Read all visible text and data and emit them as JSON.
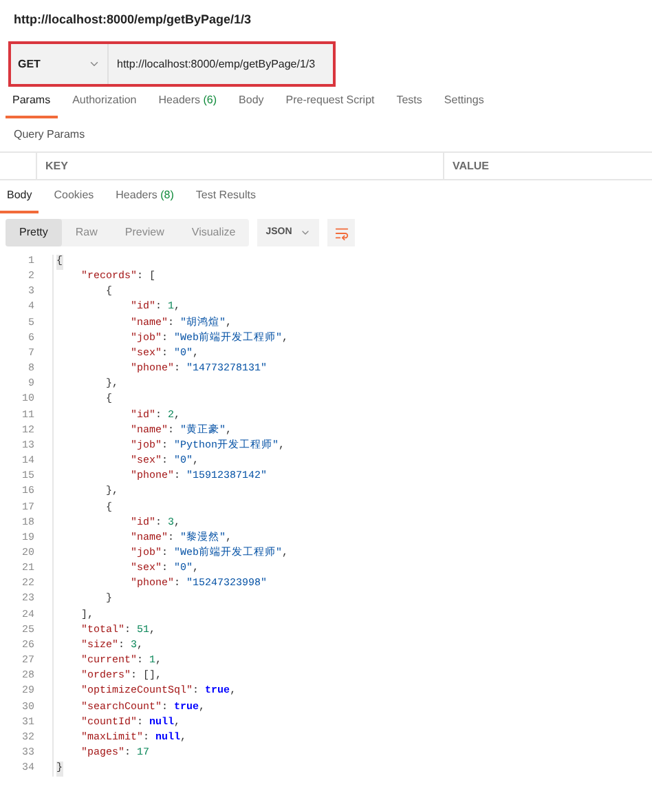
{
  "title": "http://localhost:8000/emp/getByPage/1/3",
  "request": {
    "method": "GET",
    "url": "http://localhost:8000/emp/getByPage/1/3"
  },
  "request_tabs": [
    {
      "label": "Params",
      "selected": true
    },
    {
      "label": "Authorization",
      "selected": false
    },
    {
      "label": "Headers",
      "count": "(6)",
      "selected": false
    },
    {
      "label": "Body",
      "selected": false
    },
    {
      "label": "Pre-request Script",
      "selected": false
    },
    {
      "label": "Tests",
      "selected": false
    },
    {
      "label": "Settings",
      "selected": false
    }
  ],
  "query_params": {
    "title": "Query Params",
    "columns": [
      "KEY",
      "VALUE"
    ]
  },
  "response_tabs": [
    {
      "label": "Body",
      "selected": true
    },
    {
      "label": "Cookies",
      "selected": false
    },
    {
      "label": "Headers",
      "count": "(8)",
      "selected": false
    },
    {
      "label": "Test Results",
      "selected": false
    }
  ],
  "view_modes": [
    {
      "label": "Pretty",
      "selected": true
    },
    {
      "label": "Raw",
      "selected": false
    },
    {
      "label": "Preview",
      "selected": false
    },
    {
      "label": "Visualize",
      "selected": false
    }
  ],
  "format": "JSON",
  "code_lines": [
    {
      "number": "1",
      "tokens": [
        {
          "kind": "brace",
          "text": "{"
        }
      ]
    },
    {
      "number": "2",
      "tokens": [
        {
          "kind": "key",
          "text": "    \"records\""
        },
        {
          "kind": "punct",
          "text": ": ["
        }
      ]
    },
    {
      "number": "3",
      "tokens": [
        {
          "kind": "punct",
          "text": "        {"
        }
      ]
    },
    {
      "number": "4",
      "tokens": [
        {
          "kind": "key",
          "text": "            \"id\""
        },
        {
          "kind": "punct",
          "text": ": "
        },
        {
          "kind": "number",
          "text": "1"
        },
        {
          "kind": "punct",
          "text": ","
        }
      ]
    },
    {
      "number": "5",
      "tokens": [
        {
          "kind": "key",
          "text": "            \"name\""
        },
        {
          "kind": "punct",
          "text": ": "
        },
        {
          "kind": "string",
          "text": "\"胡鸿煊\""
        },
        {
          "kind": "punct",
          "text": ","
        }
      ]
    },
    {
      "number": "6",
      "tokens": [
        {
          "kind": "key",
          "text": "            \"job\""
        },
        {
          "kind": "punct",
          "text": ": "
        },
        {
          "kind": "string",
          "text": "\"Web前端开发工程师\""
        },
        {
          "kind": "punct",
          "text": ","
        }
      ]
    },
    {
      "number": "7",
      "tokens": [
        {
          "kind": "key",
          "text": "            \"sex\""
        },
        {
          "kind": "punct",
          "text": ": "
        },
        {
          "kind": "string",
          "text": "\"0\""
        },
        {
          "kind": "punct",
          "text": ","
        }
      ]
    },
    {
      "number": "8",
      "tokens": [
        {
          "kind": "key",
          "text": "            \"phone\""
        },
        {
          "kind": "punct",
          "text": ": "
        },
        {
          "kind": "string",
          "text": "\"14773278131\""
        }
      ]
    },
    {
      "number": "9",
      "tokens": [
        {
          "kind": "punct",
          "text": "        },"
        }
      ]
    },
    {
      "number": "10",
      "tokens": [
        {
          "kind": "punct",
          "text": "        {"
        }
      ]
    },
    {
      "number": "11",
      "tokens": [
        {
          "kind": "key",
          "text": "            \"id\""
        },
        {
          "kind": "punct",
          "text": ": "
        },
        {
          "kind": "number",
          "text": "2"
        },
        {
          "kind": "punct",
          "text": ","
        }
      ]
    },
    {
      "number": "12",
      "tokens": [
        {
          "kind": "key",
          "text": "            \"name\""
        },
        {
          "kind": "punct",
          "text": ": "
        },
        {
          "kind": "string",
          "text": "\"黄正豪\""
        },
        {
          "kind": "punct",
          "text": ","
        }
      ]
    },
    {
      "number": "13",
      "tokens": [
        {
          "kind": "key",
          "text": "            \"job\""
        },
        {
          "kind": "punct",
          "text": ": "
        },
        {
          "kind": "string",
          "text": "\"Python开发工程师\""
        },
        {
          "kind": "punct",
          "text": ","
        }
      ]
    },
    {
      "number": "14",
      "tokens": [
        {
          "kind": "key",
          "text": "            \"sex\""
        },
        {
          "kind": "punct",
          "text": ": "
        },
        {
          "kind": "string",
          "text": "\"0\""
        },
        {
          "kind": "punct",
          "text": ","
        }
      ]
    },
    {
      "number": "15",
      "tokens": [
        {
          "kind": "key",
          "text": "            \"phone\""
        },
        {
          "kind": "punct",
          "text": ": "
        },
        {
          "kind": "string",
          "text": "\"15912387142\""
        }
      ]
    },
    {
      "number": "16",
      "tokens": [
        {
          "kind": "punct",
          "text": "        },"
        }
      ]
    },
    {
      "number": "17",
      "tokens": [
        {
          "kind": "punct",
          "text": "        {"
        }
      ]
    },
    {
      "number": "18",
      "tokens": [
        {
          "kind": "key",
          "text": "            \"id\""
        },
        {
          "kind": "punct",
          "text": ": "
        },
        {
          "kind": "number",
          "text": "3"
        },
        {
          "kind": "punct",
          "text": ","
        }
      ]
    },
    {
      "number": "19",
      "tokens": [
        {
          "kind": "key",
          "text": "            \"name\""
        },
        {
          "kind": "punct",
          "text": ": "
        },
        {
          "kind": "string",
          "text": "\"黎漫然\""
        },
        {
          "kind": "punct",
          "text": ","
        }
      ]
    },
    {
      "number": "20",
      "tokens": [
        {
          "kind": "key",
          "text": "            \"job\""
        },
        {
          "kind": "punct",
          "text": ": "
        },
        {
          "kind": "string",
          "text": "\"Web前端开发工程师\""
        },
        {
          "kind": "punct",
          "text": ","
        }
      ]
    },
    {
      "number": "21",
      "tokens": [
        {
          "kind": "key",
          "text": "            \"sex\""
        },
        {
          "kind": "punct",
          "text": ": "
        },
        {
          "kind": "string",
          "text": "\"0\""
        },
        {
          "kind": "punct",
          "text": ","
        }
      ]
    },
    {
      "number": "22",
      "tokens": [
        {
          "kind": "key",
          "text": "            \"phone\""
        },
        {
          "kind": "punct",
          "text": ": "
        },
        {
          "kind": "string",
          "text": "\"15247323998\""
        }
      ]
    },
    {
      "number": "23",
      "tokens": [
        {
          "kind": "punct",
          "text": "        }"
        }
      ]
    },
    {
      "number": "24",
      "tokens": [
        {
          "kind": "punct",
          "text": "    ],"
        }
      ]
    },
    {
      "number": "25",
      "tokens": [
        {
          "kind": "key",
          "text": "    \"total\""
        },
        {
          "kind": "punct",
          "text": ": "
        },
        {
          "kind": "number",
          "text": "51"
        },
        {
          "kind": "punct",
          "text": ","
        }
      ]
    },
    {
      "number": "26",
      "tokens": [
        {
          "kind": "key",
          "text": "    \"size\""
        },
        {
          "kind": "punct",
          "text": ": "
        },
        {
          "kind": "number",
          "text": "3"
        },
        {
          "kind": "punct",
          "text": ","
        }
      ]
    },
    {
      "number": "27",
      "tokens": [
        {
          "kind": "key",
          "text": "    \"current\""
        },
        {
          "kind": "punct",
          "text": ": "
        },
        {
          "kind": "number",
          "text": "1"
        },
        {
          "kind": "punct",
          "text": ","
        }
      ]
    },
    {
      "number": "28",
      "tokens": [
        {
          "kind": "key",
          "text": "    \"orders\""
        },
        {
          "kind": "punct",
          "text": ": [],"
        }
      ]
    },
    {
      "number": "29",
      "tokens": [
        {
          "kind": "key",
          "text": "    \"optimizeCountSql\""
        },
        {
          "kind": "punct",
          "text": ": "
        },
        {
          "kind": "literal",
          "text": "true"
        },
        {
          "kind": "punct",
          "text": ","
        }
      ]
    },
    {
      "number": "30",
      "tokens": [
        {
          "kind": "key",
          "text": "    \"searchCount\""
        },
        {
          "kind": "punct",
          "text": ": "
        },
        {
          "kind": "literal",
          "text": "true"
        },
        {
          "kind": "punct",
          "text": ","
        }
      ]
    },
    {
      "number": "31",
      "tokens": [
        {
          "kind": "key",
          "text": "    \"countId\""
        },
        {
          "kind": "punct",
          "text": ": "
        },
        {
          "kind": "literal",
          "text": "null"
        },
        {
          "kind": "punct",
          "text": ","
        }
      ]
    },
    {
      "number": "32",
      "tokens": [
        {
          "kind": "key",
          "text": "    \"maxLimit\""
        },
        {
          "kind": "punct",
          "text": ": "
        },
        {
          "kind": "literal",
          "text": "null"
        },
        {
          "kind": "punct",
          "text": ","
        }
      ]
    },
    {
      "number": "33",
      "tokens": [
        {
          "kind": "key",
          "text": "    \"pages\""
        },
        {
          "kind": "punct",
          "text": ": "
        },
        {
          "kind": "number",
          "text": "17"
        }
      ]
    },
    {
      "number": "34",
      "tokens": [
        {
          "kind": "brace",
          "text": "}"
        }
      ]
    }
  ]
}
